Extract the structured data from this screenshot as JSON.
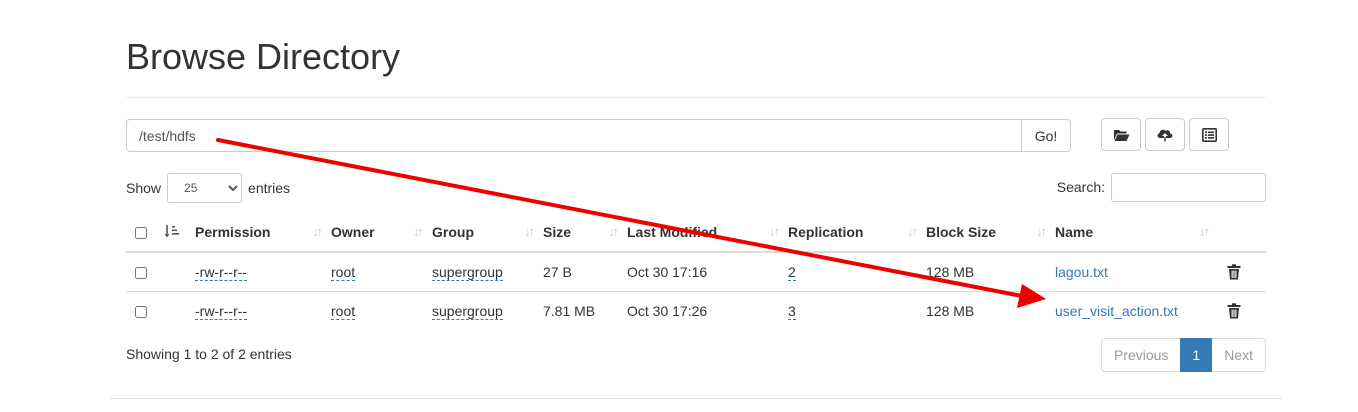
{
  "header": {
    "title": "Browse Directory"
  },
  "path_bar": {
    "value": "/test/hdfs",
    "go_label": "Go!"
  },
  "toolbar": {
    "icons": [
      "folder-open-icon",
      "cloud-upload-icon",
      "list-alt-icon"
    ]
  },
  "controls": {
    "show_label": "Show",
    "page_size": "25",
    "entries_label": "entries",
    "search_label": "Search:"
  },
  "table": {
    "columns": [
      "Permission",
      "Owner",
      "Group",
      "Size",
      "Last Modified",
      "Replication",
      "Block Size",
      "Name"
    ],
    "rows": [
      {
        "permission": "-rw-r--r--",
        "owner": "root",
        "group": "supergroup",
        "size": "27 B",
        "modified": "Oct 30 17:16",
        "replication": "2",
        "block_size": "128 MB",
        "name": "lagou.txt"
      },
      {
        "permission": "-rw-r--r--",
        "owner": "root",
        "group": "supergroup",
        "size": "7.81 MB",
        "modified": "Oct 30 17:26",
        "replication": "3",
        "block_size": "128 MB",
        "name": "user_visit_action.txt"
      }
    ]
  },
  "footer": {
    "info": "Showing 1 to 2 of 2 entries",
    "prev_label": "Previous",
    "current_page": "1",
    "next_label": "Next"
  },
  "annotation": {
    "arrow_color": "#ee0000"
  },
  "colors": {
    "link": "#337ab7",
    "active_page": "#337ab7"
  }
}
